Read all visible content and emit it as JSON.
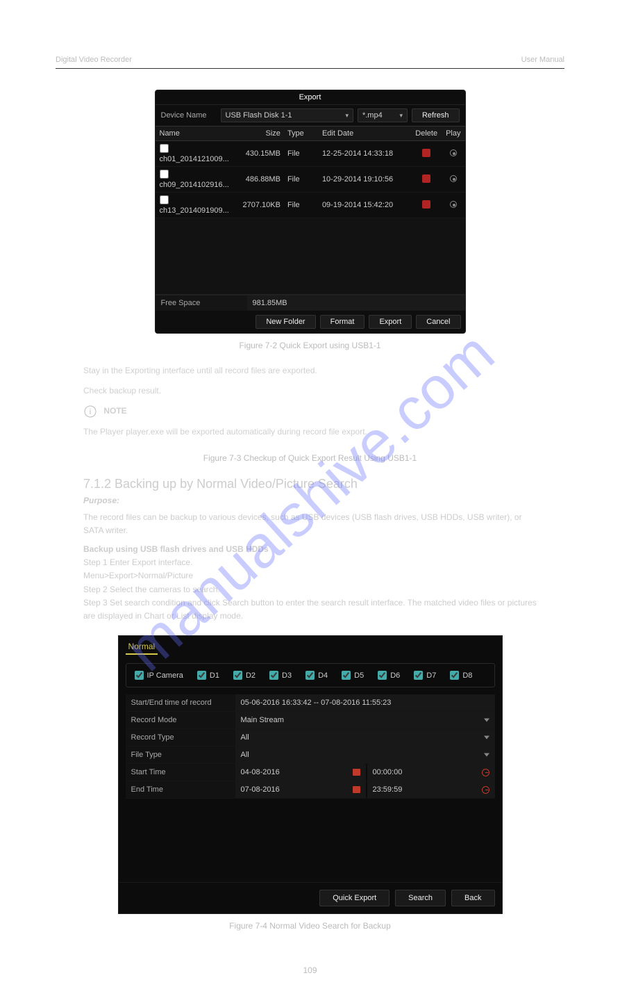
{
  "doc": {
    "header_model": "Digital Video Recorder",
    "header_manual": "User Manual",
    "page_number": "109"
  },
  "watermark": "manualshive.com",
  "export": {
    "title": "Export",
    "device_label": "Device Name",
    "device_value": "USB Flash Disk 1-1",
    "ext_value": "*.mp4",
    "refresh": "Refresh",
    "columns": {
      "name": "Name",
      "size": "Size",
      "type": "Type",
      "edit": "Edit Date",
      "del": "Delete",
      "play": "Play"
    },
    "rows": [
      {
        "name": "ch01_2014121009...",
        "size": "430.15MB",
        "type": "File",
        "edit": "12-25-2014 14:33:18"
      },
      {
        "name": "ch09_2014102916...",
        "size": "486.88MB",
        "type": "File",
        "edit": "10-29-2014 19:10:56"
      },
      {
        "name": "ch13_2014091909...",
        "size": "2707.10KB",
        "type": "File",
        "edit": "09-19-2014 15:42:20"
      }
    ],
    "free_label": "Free Space",
    "free_value": "981.85MB",
    "btn_new_folder": "New Folder",
    "btn_format": "Format",
    "btn_export": "Export",
    "btn_cancel": "Cancel"
  },
  "caption1": "Figure 7-2 Quick Export using USB1-1",
  "text1": "Stay in the Exporting interface until all record files are exported.",
  "text2": "Check backup result.",
  "note_title": "NOTE",
  "note_body": "The Player player.exe will be exported automatically during record file export.",
  "caption2": "Figure 7-3 Checkup of Quick Export Result Using USB1-1",
  "section": "7.1.2  Backing up by Normal Video/Picture Search",
  "purpose_label": "Purpose:",
  "purpose": "The record files can be backup to various devices, such as USB devices (USB flash drives, USB HDDs, USB writer), or SATA writer.",
  "backup_head": "Backup using USB flash drives and USB HDDs",
  "step1": "Step 1  Enter Export interface.",
  "step1b": "Menu>Export>Normal/Picture",
  "step2": "Step 2  Select the cameras to search.",
  "step3": "Step 3  Set search condition and click Search button to enter the search result interface. The matched video files or pictures are displayed in Chart or List display mode.",
  "normal": {
    "tab": "Normal",
    "ip_label": "IP Camera",
    "cams": [
      "D1",
      "D2",
      "D3",
      "D4",
      "D5",
      "D6",
      "D7",
      "D8"
    ],
    "se_label": "Start/End time of record",
    "se_value": "05-06-2016 16:33:42 -- 07-08-2016 11:55:23",
    "rm_label": "Record Mode",
    "rm_value": "Main Stream",
    "rt_label": "Record Type",
    "rt_value": "All",
    "ft_label": "File Type",
    "ft_value": "All",
    "st_label": "Start Time",
    "st_date": "04-08-2016",
    "st_time": "00:00:00",
    "et_label": "End Time",
    "et_date": "07-08-2016",
    "et_time": "23:59:59",
    "btn_quick": "Quick Export",
    "btn_search": "Search",
    "btn_back": "Back"
  },
  "caption3": "Figure 7-4 Normal Video Search for Backup"
}
